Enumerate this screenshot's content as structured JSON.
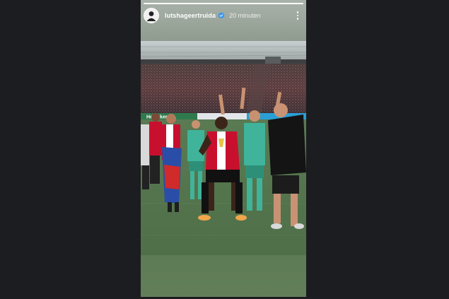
{
  "story": {
    "username": "lutshageertruida",
    "time_ago": "20 minuten",
    "verified_icon": "verified-badge-icon",
    "more_icon": "more-options-icon",
    "progress": 1.0
  },
  "photo": {
    "banner_text": "Heineken"
  },
  "colors": {
    "background": "#1c1d20",
    "verified": "#3897f0",
    "home_shirt": "#c8102e",
    "away_shirt": "#3fb49a",
    "pitch": "#5a7a52"
  }
}
